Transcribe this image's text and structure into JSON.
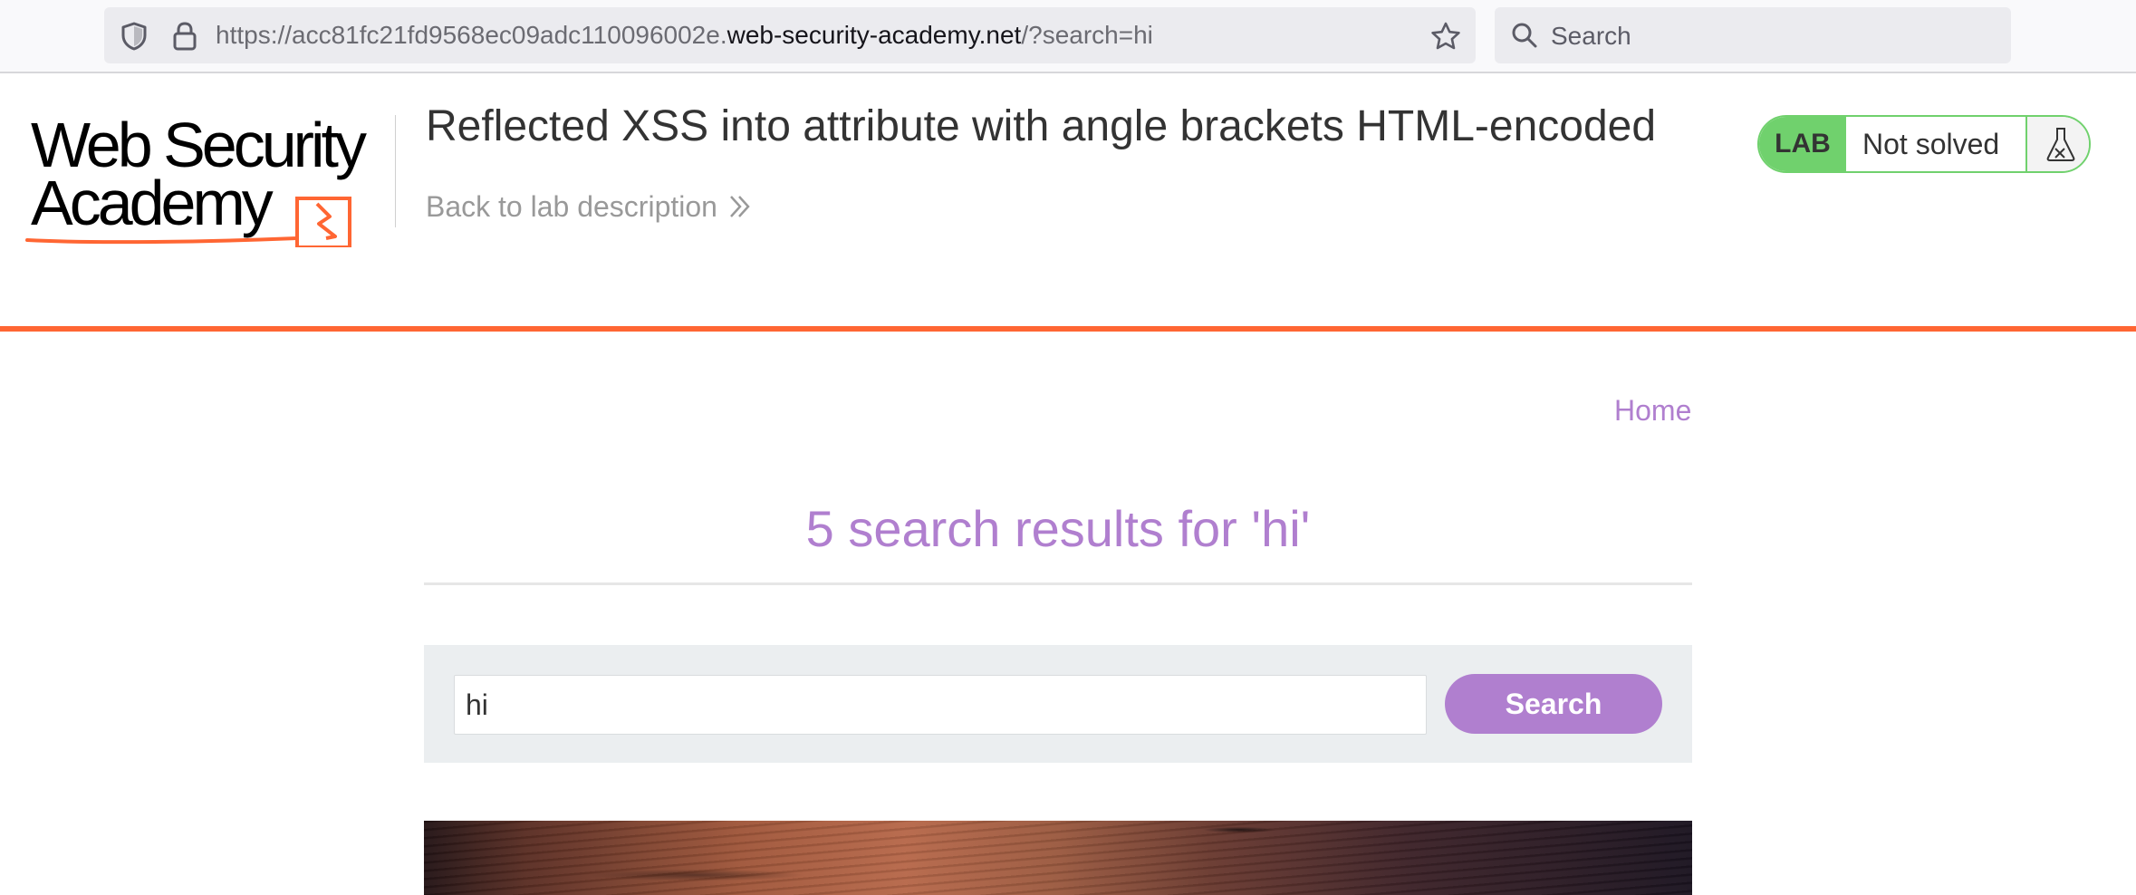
{
  "browser": {
    "url_prefix": "https://acc81fc21fd9568ec09adc110096002e.",
    "url_domain": "web-security-academy.net",
    "url_suffix": "/?search=hi",
    "search_placeholder": "Search"
  },
  "header": {
    "logo_line1": "Web Security",
    "logo_line2": "Academy",
    "lab_title": "Reflected XSS into attribute with angle brackets HTML-encoded",
    "back_link": "Back to lab description",
    "badge_label": "LAB",
    "badge_status": "Not solved",
    "accent_color": "#ff6633",
    "badge_color": "#70d16d"
  },
  "nav": {
    "home": "Home"
  },
  "results": {
    "heading": "5 search results for 'hi'",
    "heading_color": "#b07fcf"
  },
  "search": {
    "value": "hi",
    "button_label": "Search"
  }
}
